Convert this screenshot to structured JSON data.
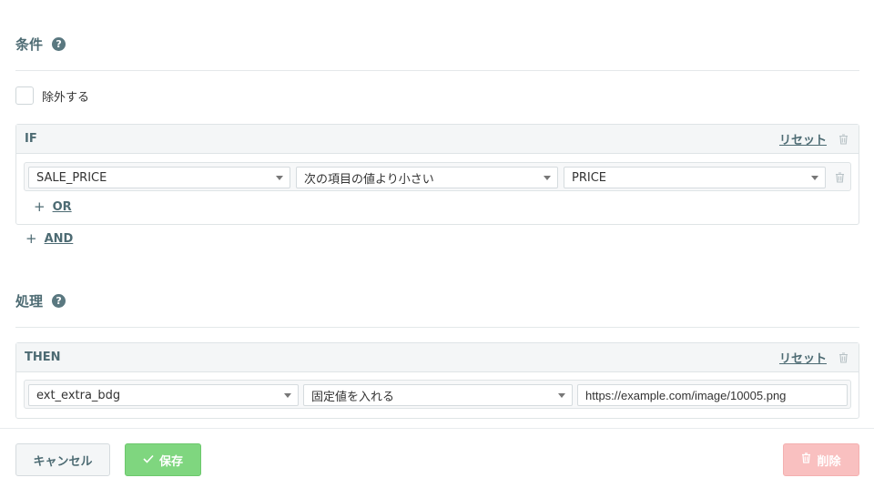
{
  "conditions": {
    "title": "条件",
    "help": "?",
    "exclude_label": "除外する",
    "if_panel": {
      "label": "IF",
      "reset": "リセット",
      "row": {
        "field": "SALE_PRICE",
        "operator": "次の項目の値より小さい",
        "value": "PRICE"
      },
      "or_label": "OR"
    },
    "and_label": "AND"
  },
  "actions": {
    "title": "処理",
    "help": "?",
    "then_panel": {
      "label": "THEN",
      "reset": "リセット",
      "row": {
        "field": "ext_extra_bdg",
        "operation": "固定値を入れる",
        "value": "https://example.com/image/10005.png"
      }
    }
  },
  "footer": {
    "cancel": "キャンセル",
    "save": "保存",
    "delete": "削除"
  },
  "icons": {
    "help": "question-circle-icon",
    "trash": "trash-icon",
    "plus": "plus-icon",
    "check": "check-icon"
  },
  "colors": {
    "accent": "#4d6b73",
    "save": "#7fd67f",
    "delete": "#f9c0c0"
  }
}
